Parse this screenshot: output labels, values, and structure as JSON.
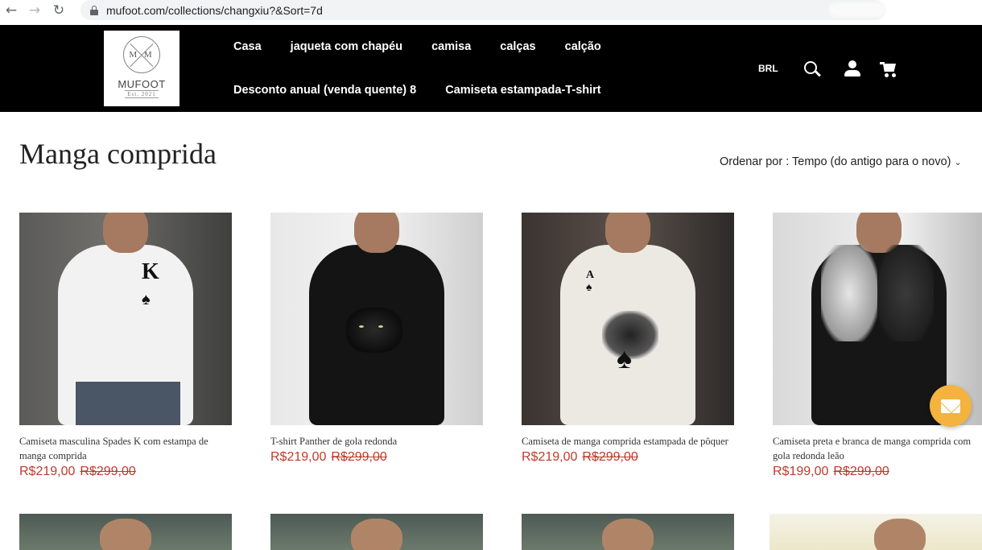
{
  "browser": {
    "url": "mufoot.com/collections/changxiu?&Sort=7d"
  },
  "logo": {
    "monogram": "M M",
    "name": "MUFOOT",
    "est": "Est. 2021"
  },
  "nav": {
    "row1": [
      "Casa",
      "jaqueta com chapéu",
      "camisa",
      "calças",
      "calção"
    ],
    "row2": [
      "Desconto anual (venda quente) 8",
      "Camiseta estampada-T-shirt"
    ]
  },
  "header": {
    "currency": "BRL"
  },
  "collection": {
    "title": "Manga comprida",
    "sort_label": "Ordenar por : Tempo (do antigo para o novo)"
  },
  "products": [
    {
      "name": "Camiseta masculina Spades K com estampa de manga comprida",
      "price": "R$219,00",
      "original_price": "R$299,00"
    },
    {
      "name": "T-shirt Panther de gola redonda",
      "price": "R$219,00",
      "original_price": "R$299,00"
    },
    {
      "name": "Camiseta de manga comprida estampada de pôquer",
      "price": "R$219,00",
      "original_price": "R$299,00"
    },
    {
      "name": "Camiseta preta e branca de manga comprida com gola redonda leão",
      "price": "R$199,00",
      "original_price": "R$299,00"
    }
  ],
  "icons": {
    "search": "search-icon",
    "account": "user-icon",
    "cart": "cart-icon",
    "contact": "mail-icon"
  },
  "colors": {
    "header_bg": "#000000",
    "price": "#c0392b",
    "fab": "#f3b33e"
  }
}
